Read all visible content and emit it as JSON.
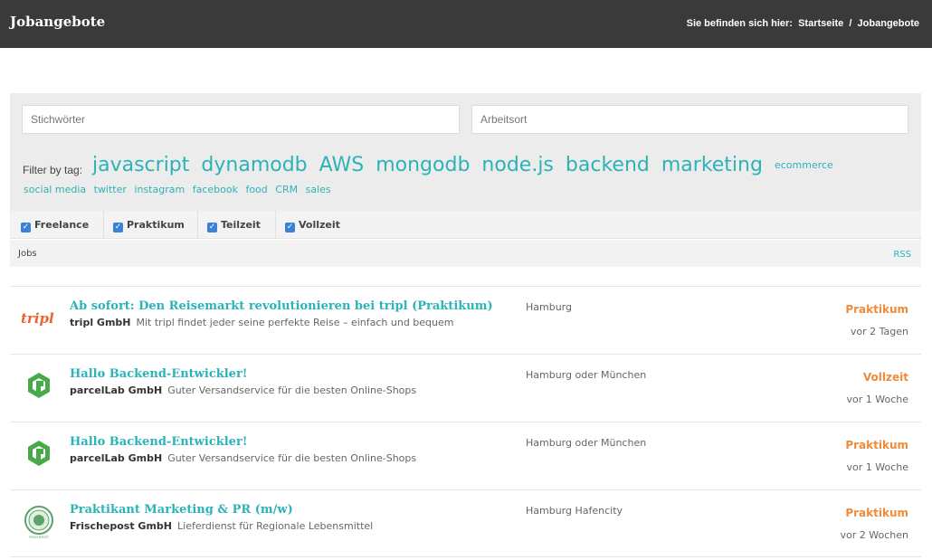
{
  "header": {
    "title": "Jobangebote",
    "breadcrumb_prefix": "Sie befinden sich hier:",
    "breadcrumb_home": "Startseite",
    "breadcrumb_sep": "/",
    "breadcrumb_current": "Jobangebote"
  },
  "search": {
    "keywords_placeholder": "Stichwörter",
    "location_placeholder": "Arbeitsort"
  },
  "tags": {
    "label": "Filter by tag:",
    "large": [
      "javascript",
      "dynamodb",
      "AWS",
      "mongodb",
      "node.js",
      "backend",
      "marketing"
    ],
    "inline_small": "ecommerce",
    "small": [
      "social media",
      "twitter",
      "instagram",
      "facebook",
      "food",
      "CRM",
      "sales"
    ]
  },
  "filters": {
    "items": [
      {
        "label": "Freelance",
        "checked": true
      },
      {
        "label": "Praktikum",
        "checked": true
      },
      {
        "label": "Teilzeit",
        "checked": true
      },
      {
        "label": "Vollzeit",
        "checked": true
      }
    ]
  },
  "jobs_header": {
    "label": "Jobs",
    "rss": "RSS"
  },
  "jobs": [
    {
      "logo": "tripl-logo",
      "logo_text": "tripl",
      "title": "Ab sofort: Den Reisemarkt revolutionieren bei tripl (Praktikum)",
      "company": "tripl GmbH",
      "description": "Mit tripl findet jeder seine perfekte Reise – einfach und bequem",
      "location": "Hamburg",
      "type": "Praktikum",
      "age": "vor 2 Tagen"
    },
    {
      "logo": "parcellab-logo",
      "title": "Hallo Backend-Entwickler!",
      "company": "parcelLab GmbH",
      "description": "Guter Versandservice für die besten Online-Shops",
      "location": "Hamburg oder München",
      "type": "Vollzeit",
      "age": "vor 1 Woche"
    },
    {
      "logo": "parcellab-logo",
      "title": "Hallo Backend-Entwickler!",
      "company": "parcelLab GmbH",
      "description": "Guter Versandservice für die besten Online-Shops",
      "location": "Hamburg oder München",
      "type": "Praktikum",
      "age": "vor 1 Woche"
    },
    {
      "logo": "frischepost-logo",
      "logo_text": "FRISCHEPOST",
      "title": "Praktikant Marketing & PR (m/w)",
      "company": "Frischepost GmbH",
      "description": "Lieferdienst für Regionale Lebensmittel",
      "location": "Hamburg Hafencity",
      "type": "Praktikum",
      "age": "vor 2 Wochen"
    }
  ],
  "colors": {
    "accent": "#2bb3b8",
    "job_type": "#ef8b3a",
    "header_bg": "#3a3a3a",
    "checkbox": "#3b82d6"
  }
}
